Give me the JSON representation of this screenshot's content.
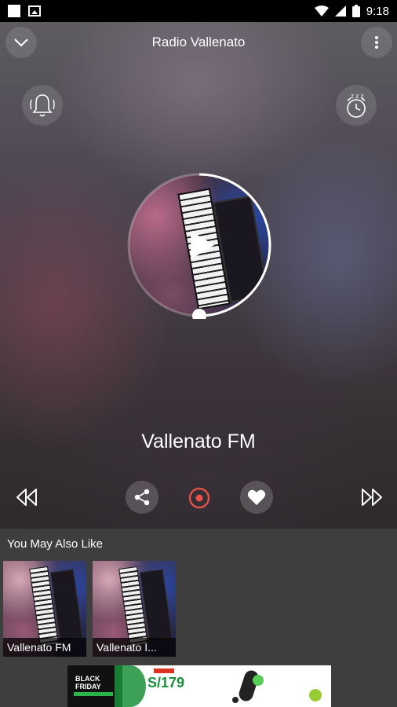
{
  "status_bar": {
    "time": "9:18"
  },
  "header": {
    "title": "Radio Vallenato"
  },
  "player": {
    "station_name": "Vallenato FM",
    "progress": 0.5
  },
  "recommendations": {
    "title": "You May Also Like",
    "items": [
      {
        "label": "Vallenato FM"
      },
      {
        "label": "Vallenato I..."
      }
    ]
  },
  "ad": {
    "line1": "BLACK",
    "line2": "FRIDAY",
    "price": "S/179"
  },
  "colors": {
    "accent": "#e5534b",
    "background": "#3e3e3e"
  },
  "icons": {
    "collapse": "chevron-down-icon",
    "menu": "more-vert-icon",
    "notification": "bell-ring-icon",
    "sleep": "alarm-zzz-icon",
    "play": "play-icon",
    "prev": "rewind-icon",
    "share": "share-icon",
    "record": "record-icon",
    "favorite": "heart-icon",
    "next": "fast-forward-icon"
  }
}
